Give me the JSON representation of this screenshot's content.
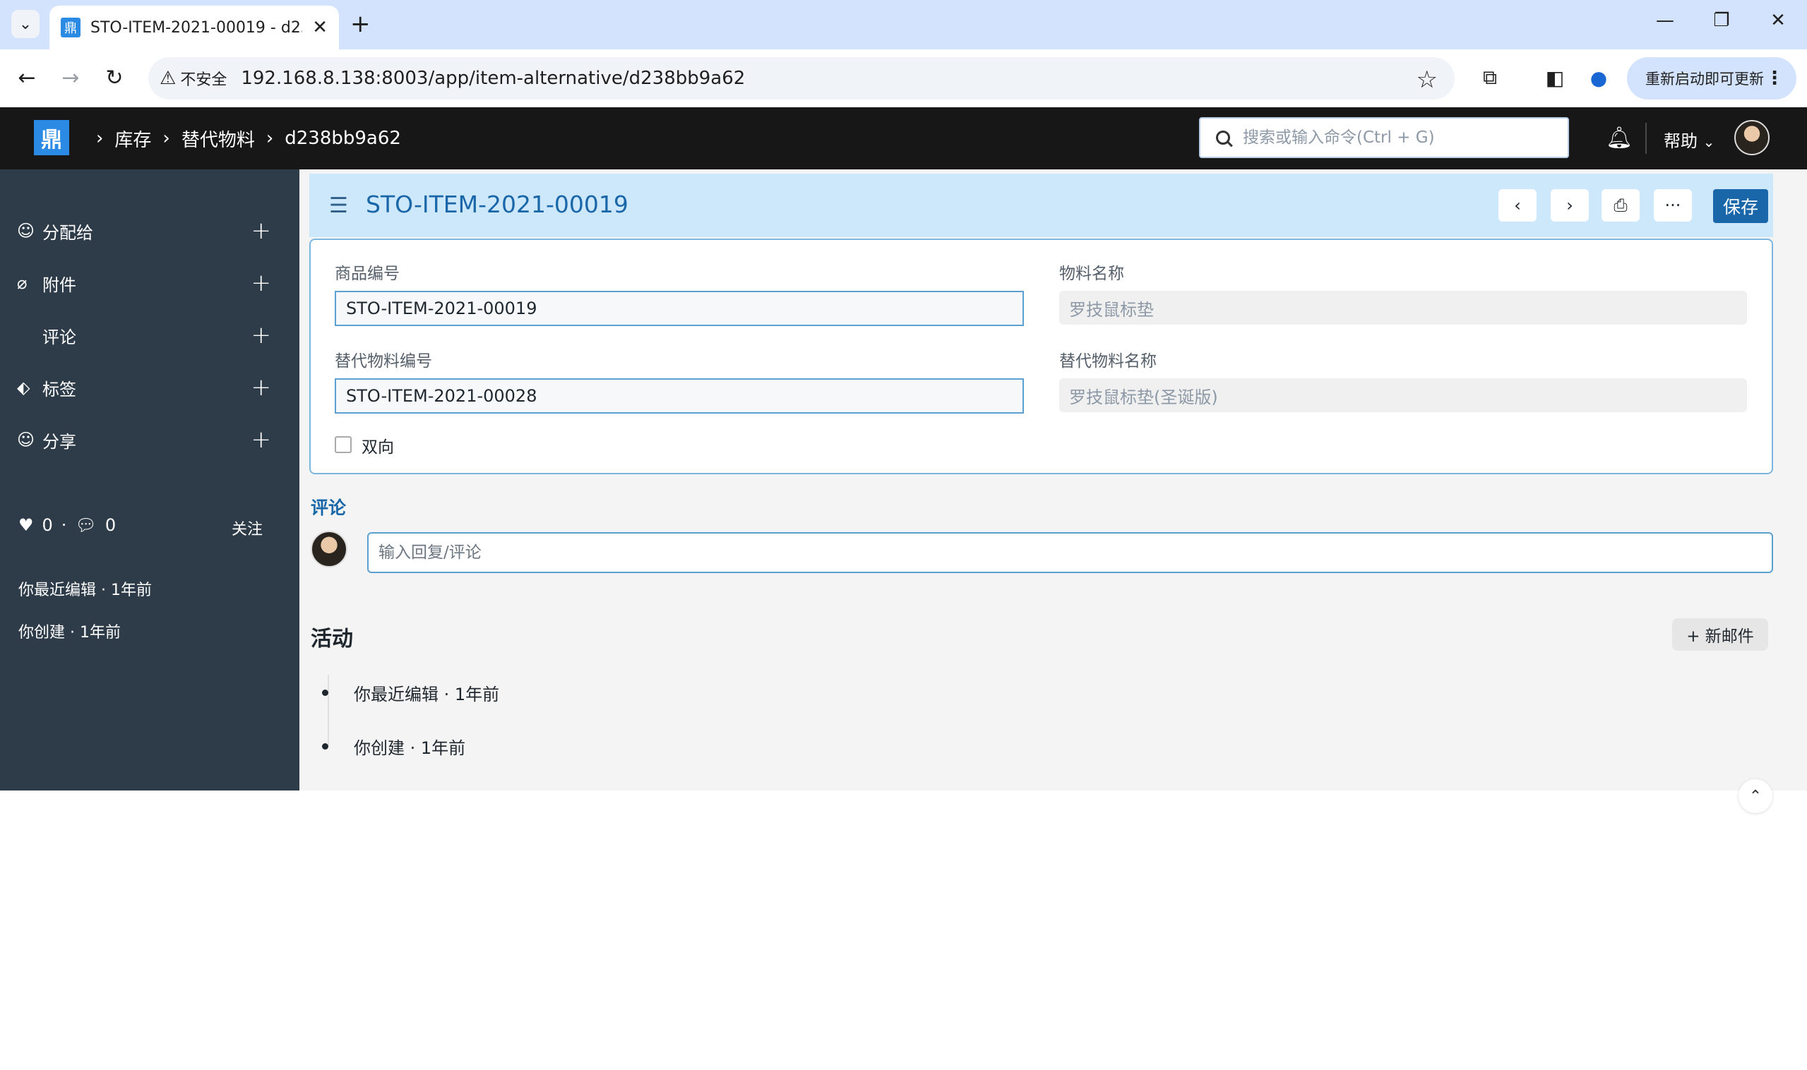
{
  "browser": {
    "tab_title": "STO-ITEM-2021-00019 - d238",
    "security_label": "不安全",
    "url": "192.168.8.138:8003/app/item-alternative/d238bb9a62",
    "update_button": "重新启动即可更新"
  },
  "navbar": {
    "breadcrumbs": [
      "库存",
      "替代物料",
      "d238bb9a62"
    ],
    "search_placeholder": "搜索或输入命令(Ctrl + G)",
    "help_label": "帮助"
  },
  "sidebar": {
    "items": [
      {
        "label": "分配给",
        "icon": "user-circle-icon"
      },
      {
        "label": "附件",
        "icon": "paperclip-icon"
      },
      {
        "label": "评论",
        "icon": ""
      },
      {
        "label": "标签",
        "icon": "tag-icon"
      },
      {
        "label": "分享",
        "icon": "share-user-icon"
      }
    ],
    "likes": "0",
    "comments": "0",
    "follow_label": "关注",
    "last_edited": "你最近编辑 · 1年前",
    "created": "你创建 · 1年前"
  },
  "page": {
    "title": "STO-ITEM-2021-00019",
    "save_label": "保存",
    "more_label": "···"
  },
  "form": {
    "item_code_label": "商品编号",
    "item_code_value": "STO-ITEM-2021-00019",
    "item_name_label": "物料名称",
    "item_name_value": "罗技鼠标垫",
    "alt_code_label": "替代物料编号",
    "alt_code_value": "STO-ITEM-2021-00028",
    "alt_name_label": "替代物料名称",
    "alt_name_value": "罗技鼠标垫(圣诞版)",
    "two_way_label": "双向"
  },
  "comments": {
    "heading": "评论",
    "input_placeholder": "输入回复/评论"
  },
  "activity": {
    "heading": "活动",
    "new_email_label": "+ 新邮件",
    "items": [
      "你最近编辑 · 1年前",
      "你创建 · 1年前"
    ]
  }
}
